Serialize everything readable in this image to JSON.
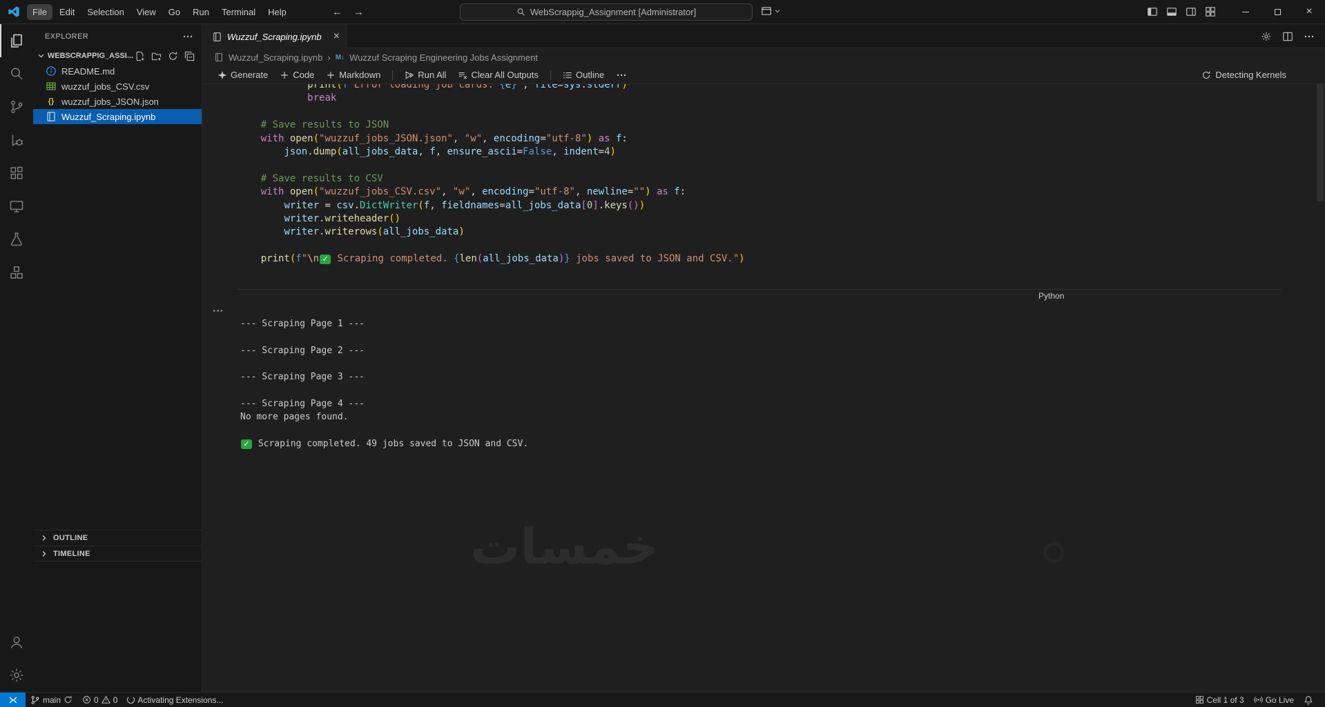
{
  "title_bar": {
    "menus": [
      "File",
      "Edit",
      "Selection",
      "View",
      "Go",
      "Run",
      "Terminal",
      "Help"
    ],
    "search": "WebScrappig_Assignment [Administrator]"
  },
  "sidebar": {
    "panel_title": "EXPLORER",
    "project": "WEBSCRAPPIG_ASSI...",
    "files": [
      {
        "name": "README.md",
        "icon": "info-icon"
      },
      {
        "name": "wuzzuf_jobs_CSV.csv",
        "icon": "table-icon"
      },
      {
        "name": "wuzzuf_jobs_JSON.json",
        "icon": "braces-icon"
      },
      {
        "name": "Wuzzuf_Scraping.ipynb",
        "icon": "notebook-icon",
        "selected": true
      }
    ],
    "outline_label": "OUTLINE",
    "timeline_label": "TIMELINE"
  },
  "tab": {
    "label": "Wuzzuf_Scraping.ipynb"
  },
  "breadcrumb": {
    "file": "Wuzzuf_Scraping.ipynb",
    "section": "Wuzzuf Scraping Engineering Jobs Assignment",
    "markdown_badge": "M↓"
  },
  "nbtoolbar": {
    "generate": "Generate",
    "code": "Code",
    "markdown": "Markdown",
    "run_all": "Run All",
    "clear_outputs": "Clear All Outputs",
    "outline": "Outline",
    "kernel_status": "Detecting Kernels"
  },
  "cell": {
    "language": "Python",
    "code_lines": [
      [
        [
          "            ",
          "p"
        ],
        [
          "print",
          "fn"
        ],
        [
          "(",
          "b1"
        ],
        [
          "f",
          "const"
        ],
        [
          "\"Error loading job cards: ",
          "str"
        ],
        [
          "{",
          "fb"
        ],
        [
          "e",
          "var"
        ],
        [
          "}",
          "fb"
        ],
        [
          "\"",
          "str"
        ],
        [
          ", ",
          "p"
        ],
        [
          "file",
          "var"
        ],
        [
          "=",
          "p"
        ],
        [
          "sys",
          "var"
        ],
        [
          ".",
          "p"
        ],
        [
          "stderr",
          "var"
        ],
        [
          ")",
          "b1"
        ]
      ],
      [
        [
          "            ",
          "p"
        ],
        [
          "break",
          "kw"
        ]
      ],
      [],
      [
        [
          "    ",
          "p"
        ],
        [
          "# Save results to JSON",
          "cm"
        ]
      ],
      [
        [
          "    ",
          "p"
        ],
        [
          "with",
          "kw"
        ],
        [
          " ",
          "p"
        ],
        [
          "open",
          "fn"
        ],
        [
          "(",
          "b1"
        ],
        [
          "\"wuzzuf_jobs_JSON.json\"",
          "str"
        ],
        [
          ", ",
          "p"
        ],
        [
          "\"w\"",
          "str"
        ],
        [
          ", ",
          "p"
        ],
        [
          "encoding",
          "var"
        ],
        [
          "=",
          "p"
        ],
        [
          "\"utf-8\"",
          "str"
        ],
        [
          ")",
          "b1"
        ],
        [
          " ",
          "p"
        ],
        [
          "as",
          "kw"
        ],
        [
          " ",
          "p"
        ],
        [
          "f",
          "var"
        ],
        [
          ":",
          "p"
        ]
      ],
      [
        [
          "        ",
          "p"
        ],
        [
          "json",
          "var"
        ],
        [
          ".",
          "p"
        ],
        [
          "dump",
          "fn"
        ],
        [
          "(",
          "b1"
        ],
        [
          "all_jobs_data",
          "var"
        ],
        [
          ", ",
          "p"
        ],
        [
          "f",
          "var"
        ],
        [
          ", ",
          "p"
        ],
        [
          "ensure_ascii",
          "var"
        ],
        [
          "=",
          "p"
        ],
        [
          "False",
          "const"
        ],
        [
          ", ",
          "p"
        ],
        [
          "indent",
          "var"
        ],
        [
          "=",
          "p"
        ],
        [
          "4",
          "num"
        ],
        [
          ")",
          "b1"
        ]
      ],
      [],
      [
        [
          "    ",
          "p"
        ],
        [
          "# Save results to CSV",
          "cm"
        ]
      ],
      [
        [
          "    ",
          "p"
        ],
        [
          "with",
          "kw"
        ],
        [
          " ",
          "p"
        ],
        [
          "open",
          "fn"
        ],
        [
          "(",
          "b1"
        ],
        [
          "\"wuzzuf_jobs_CSV.csv\"",
          "str"
        ],
        [
          ", ",
          "p"
        ],
        [
          "\"w\"",
          "str"
        ],
        [
          ", ",
          "p"
        ],
        [
          "encoding",
          "var"
        ],
        [
          "=",
          "p"
        ],
        [
          "\"utf-8\"",
          "str"
        ],
        [
          ", ",
          "p"
        ],
        [
          "newline",
          "var"
        ],
        [
          "=",
          "p"
        ],
        [
          "\"\"",
          "str"
        ],
        [
          ")",
          "b1"
        ],
        [
          " ",
          "p"
        ],
        [
          "as",
          "kw"
        ],
        [
          " ",
          "p"
        ],
        [
          "f",
          "var"
        ],
        [
          ":",
          "p"
        ]
      ],
      [
        [
          "        ",
          "p"
        ],
        [
          "writer",
          "var"
        ],
        [
          " = ",
          "p"
        ],
        [
          "csv",
          "var"
        ],
        [
          ".",
          "p"
        ],
        [
          "DictWriter",
          "cls"
        ],
        [
          "(",
          "b1"
        ],
        [
          "f",
          "var"
        ],
        [
          ", ",
          "p"
        ],
        [
          "fieldnames",
          "var"
        ],
        [
          "=",
          "p"
        ],
        [
          "all_jobs_data",
          "var"
        ],
        [
          "[",
          "b2"
        ],
        [
          "0",
          "num"
        ],
        [
          "]",
          "b2"
        ],
        [
          ".",
          "p"
        ],
        [
          "keys",
          "fn"
        ],
        [
          "(",
          "b2"
        ],
        [
          ")",
          "b2"
        ],
        [
          ")",
          "b1"
        ]
      ],
      [
        [
          "        ",
          "p"
        ],
        [
          "writer",
          "var"
        ],
        [
          ".",
          "p"
        ],
        [
          "writeheader",
          "fn"
        ],
        [
          "(",
          "b1"
        ],
        [
          ")",
          "b1"
        ]
      ],
      [
        [
          "        ",
          "p"
        ],
        [
          "writer",
          "var"
        ],
        [
          ".",
          "p"
        ],
        [
          "writerows",
          "fn"
        ],
        [
          "(",
          "b1"
        ],
        [
          "all_jobs_data",
          "var"
        ],
        [
          ")",
          "b1"
        ]
      ],
      [],
      [
        [
          "    ",
          "p"
        ],
        [
          "print",
          "fn"
        ],
        [
          "(",
          "b1"
        ],
        [
          "f",
          "const"
        ],
        [
          "\"",
          "str"
        ],
        [
          "\\n",
          "esc"
        ],
        [
          "✓",
          "check"
        ],
        [
          " Scraping completed. ",
          "str"
        ],
        [
          "{",
          "fb"
        ],
        [
          "len",
          "fn"
        ],
        [
          "(",
          "b2"
        ],
        [
          "all_jobs_data",
          "var"
        ],
        [
          ")",
          "b2"
        ],
        [
          "}",
          "fb"
        ],
        [
          " jobs saved to JSON and CSV.\"",
          "str"
        ],
        [
          ")",
          "b1"
        ]
      ],
      []
    ]
  },
  "output": {
    "lines": [
      [
        [
          "--- Scraping Page 1 ---",
          "out"
        ]
      ],
      [],
      [
        [
          "--- Scraping Page 2 ---",
          "out"
        ]
      ],
      [],
      [
        [
          "--- Scraping Page 3 ---",
          "out"
        ]
      ],
      [],
      [
        [
          "--- Scraping Page 4 ---",
          "out"
        ]
      ],
      [
        [
          "No more pages found.",
          "out"
        ]
      ],
      [],
      [
        [
          "✓",
          "check"
        ],
        [
          " Scraping completed. 49 jobs saved to JSON and CSV.",
          "out"
        ]
      ]
    ]
  },
  "watermark": {
    "text": "خمسات"
  },
  "status_bar": {
    "branch": "main",
    "errors": "0",
    "warnings": "0",
    "activating": "Activating Extensions...",
    "cell_position": "Cell 1 of 3",
    "go_live": "Go Live"
  },
  "colors": {
    "accent": "#0078d4",
    "list_selection": "#0b5dad",
    "check_green": "#26a541",
    "editor_bg": "#1f1f1f",
    "panel_bg": "#181818"
  }
}
